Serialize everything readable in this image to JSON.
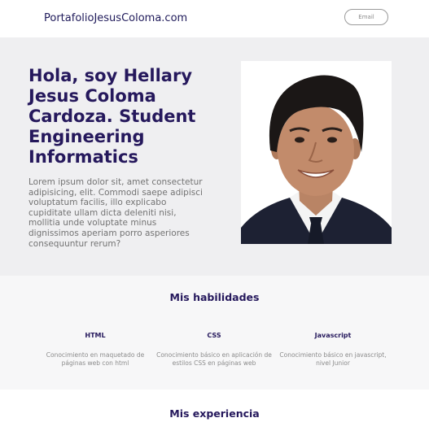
{
  "header": {
    "brand": "PortafolioJesusColoma.com",
    "email_button": "Email"
  },
  "hero": {
    "title": "Hola, soy Hellary Jesus Coloma Cardoza. Student Engineering Informatics",
    "description": "Lorem ipsum dolor sit, amet consectetur adipisicing, elit. Commodi saepe adipisci voluptatum facilis, illo explicabo cupiditate ullam dicta deleniti nisi, mollitia unde voluptate minus dignissimos aperiam porro asperiores consequuntur rerum?"
  },
  "skills": {
    "title": "Mis habilidades",
    "items": [
      {
        "name": "HTML",
        "description": "Conocimiento en maquetado de páginas web con html"
      },
      {
        "name": "CSS",
        "description": "Conocimiento básico en aplicación de estilos CSS en páginas web"
      },
      {
        "name": "Javascript",
        "description": "Conocimiento básico en javascript, nivel Junior"
      }
    ]
  },
  "experience": {
    "title": "Mis experiencia"
  },
  "colors": {
    "accent": "#25185c",
    "hero_background": "#efeff1",
    "body_text": "#737373"
  }
}
